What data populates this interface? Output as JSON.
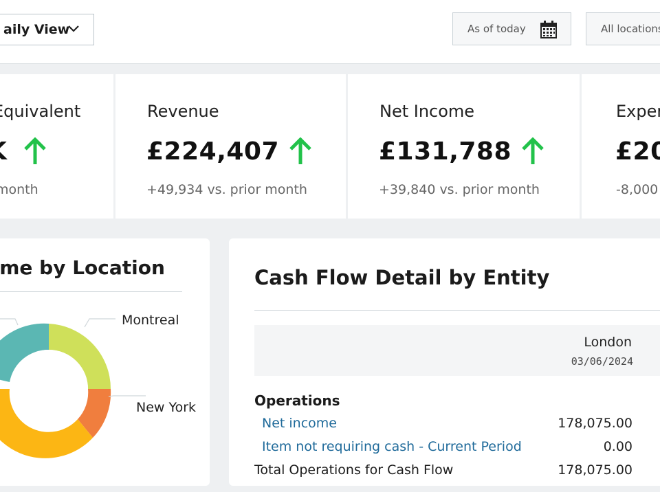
{
  "header": {
    "view_label": "aily View",
    "as_of_label": "As of today",
    "locations_label": "All locations"
  },
  "kpis": [
    {
      "title": "Equivalent",
      "value": "K",
      "delta": "month"
    },
    {
      "title": "Revenue",
      "value": "£224,407",
      "delta": "+49,934 vs. prior month"
    },
    {
      "title": "Net Income",
      "value": "£131,788",
      "delta": "+39,840 vs. prior month"
    },
    {
      "title": "Exper",
      "value": "£20",
      "delta": "-8,000"
    }
  ],
  "colors": {
    "up_arrow": "#22c24a",
    "link": "#1f6a9a",
    "donut": [
      "#cfe05a",
      "#f07e3e",
      "#fcb614",
      "#5bb7b3"
    ]
  },
  "income_by_location": {
    "title": "ome by Location",
    "legend": [
      "Montreal",
      "New York"
    ]
  },
  "cash_flow": {
    "title": "Cash Flow Detail by Entity",
    "column": {
      "entity": "London",
      "date": "03/06/2024"
    },
    "section": "Operations",
    "rows": [
      {
        "label": "Net income",
        "amount": "178,075.00"
      },
      {
        "label": "Item not requiring cash - Current Period",
        "amount": "0.00"
      },
      {
        "label": "Total Operations for Cash Flow",
        "amount": "178,075.00"
      }
    ]
  }
}
